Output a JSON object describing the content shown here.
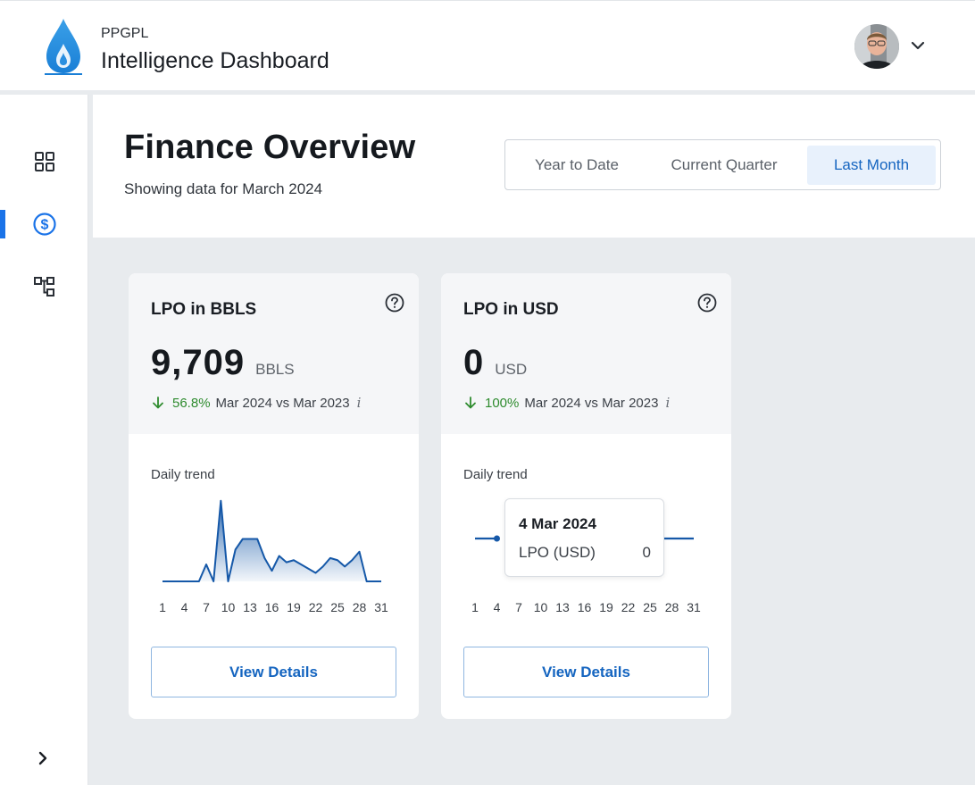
{
  "header": {
    "brand_small": "PPGPL",
    "brand_title": "Intelligence Dashboard",
    "logo_icon": "water-drop-flame-logo",
    "user_menu_icon": "chevron-down-icon",
    "accent_color": "#1a73e8"
  },
  "sidebar": {
    "items": [
      {
        "icon": "dashboard-grid-icon",
        "active": false
      },
      {
        "icon": "dollar-circle-icon",
        "active": true
      },
      {
        "icon": "hierarchy-icon",
        "active": false
      }
    ],
    "expand_icon": "chevron-right-icon"
  },
  "page": {
    "title": "Finance Overview",
    "subtitle": "Showing data for March 2024",
    "ranges": [
      "Year to Date",
      "Current Quarter",
      "Last Month"
    ],
    "selected_range": "Last Month"
  },
  "cards": [
    {
      "title": "LPO in BBLS",
      "value": "9,709",
      "unit": "BBLS",
      "delta_pct": "56.8%",
      "delta_direction": "down",
      "delta_text": "Mar 2024 vs Mar 2023",
      "info": "i",
      "trend_label": "Daily trend",
      "button": "View Details"
    },
    {
      "title": "LPO in USD",
      "value": "0",
      "unit": "USD",
      "delta_pct": "100%",
      "delta_direction": "down",
      "delta_text": "Mar 2024 vs Mar 2023",
      "info": "i",
      "trend_label": "Daily trend",
      "button": "View Details",
      "tooltip": {
        "date": "4 Mar 2024",
        "label": "LPO (USD)",
        "value": "0"
      }
    }
  ],
  "chart_data": [
    {
      "type": "area",
      "title": "",
      "x_ticks": [
        "1",
        "4",
        "7",
        "10",
        "13",
        "16",
        "19",
        "22",
        "25",
        "28",
        "31"
      ],
      "x": [
        1,
        2,
        3,
        4,
        5,
        6,
        7,
        8,
        9,
        10,
        11,
        12,
        13,
        14,
        15,
        16,
        17,
        18,
        19,
        20,
        21,
        22,
        23,
        24,
        25,
        26,
        27,
        28,
        29,
        30,
        31
      ],
      "y": [
        0,
        0,
        0,
        0,
        0,
        0,
        800,
        0,
        3800,
        0,
        1500,
        2000,
        2000,
        2000,
        1100,
        500,
        1200,
        900,
        1000,
        800,
        600,
        400,
        700,
        1100,
        1000,
        700,
        1000,
        1400,
        0,
        0,
        0
      ],
      "ylim": [
        0,
        4000
      ],
      "color": "#1558a8",
      "fill": "gradient"
    },
    {
      "type": "line",
      "title": "",
      "x_ticks": [
        "1",
        "4",
        "7",
        "10",
        "13",
        "16",
        "19",
        "22",
        "25",
        "28",
        "31"
      ],
      "x": [
        1,
        2,
        3,
        4,
        5,
        6,
        7,
        8,
        9,
        10,
        11,
        12,
        13,
        14,
        15,
        16,
        17,
        18,
        19,
        20,
        21,
        22,
        23,
        24,
        25,
        26,
        27,
        28,
        29,
        30,
        31
      ],
      "y": [
        0,
        0,
        0,
        0,
        0,
        0,
        0,
        0,
        0,
        0,
        0,
        0,
        0,
        0,
        0,
        0,
        0,
        0,
        0,
        0,
        0,
        0,
        0,
        0,
        0,
        0,
        0,
        0,
        0,
        0,
        0
      ],
      "highlight_x": 4,
      "color": "#1558a8"
    }
  ]
}
